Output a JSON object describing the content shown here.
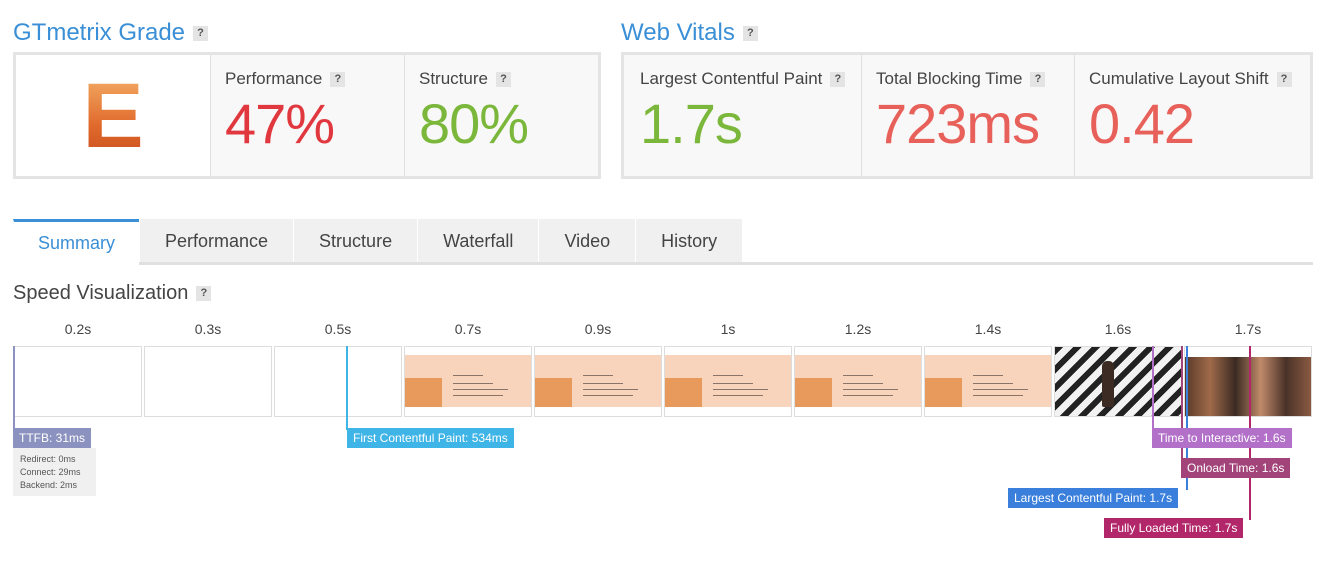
{
  "grade": {
    "title": "GTmetrix Grade",
    "letter": "E",
    "performance_label": "Performance",
    "performance_value": "47%",
    "structure_label": "Structure",
    "structure_value": "80%"
  },
  "vitals": {
    "title": "Web Vitals",
    "lcp_label": "Largest Contentful Paint",
    "lcp_value": "1.7s",
    "tbt_label": "Total Blocking Time",
    "tbt_value": "723ms",
    "cls_label": "Cumulative Layout Shift",
    "cls_value": "0.42"
  },
  "help_glyph": "?",
  "tabs": [
    "Summary",
    "Performance",
    "Structure",
    "Waterfall",
    "Video",
    "History"
  ],
  "speed": {
    "title": "Speed Visualization",
    "times": [
      "0.2s",
      "0.3s",
      "0.5s",
      "0.7s",
      "0.9s",
      "1s",
      "1.2s",
      "1.4s",
      "1.6s",
      "1.7s"
    ],
    "markers": {
      "ttfb": "TTFB: 31ms",
      "fcp": "First Contentful Paint: 534ms",
      "tti": "Time to Interactive: 1.6s",
      "onload": "Onload Time: 1.6s",
      "lcp": "Largest Contentful Paint: 1.7s",
      "fully": "Fully Loaded Time: 1.7s"
    },
    "ttfb_details": [
      "Redirect: 0ms",
      "Connect: 29ms",
      "Backend: 2ms"
    ]
  },
  "colors": {
    "accent": "#3a8fd6",
    "bad": "#e0383e",
    "good": "#7ab73a",
    "warn": "#e8605a",
    "ttfb": "#8c92bf",
    "fcp": "#3fb4e6",
    "tti": "#b270c8",
    "onload": "#a2447a",
    "lcp": "#3a7fdc",
    "fully": "#b2276a"
  }
}
